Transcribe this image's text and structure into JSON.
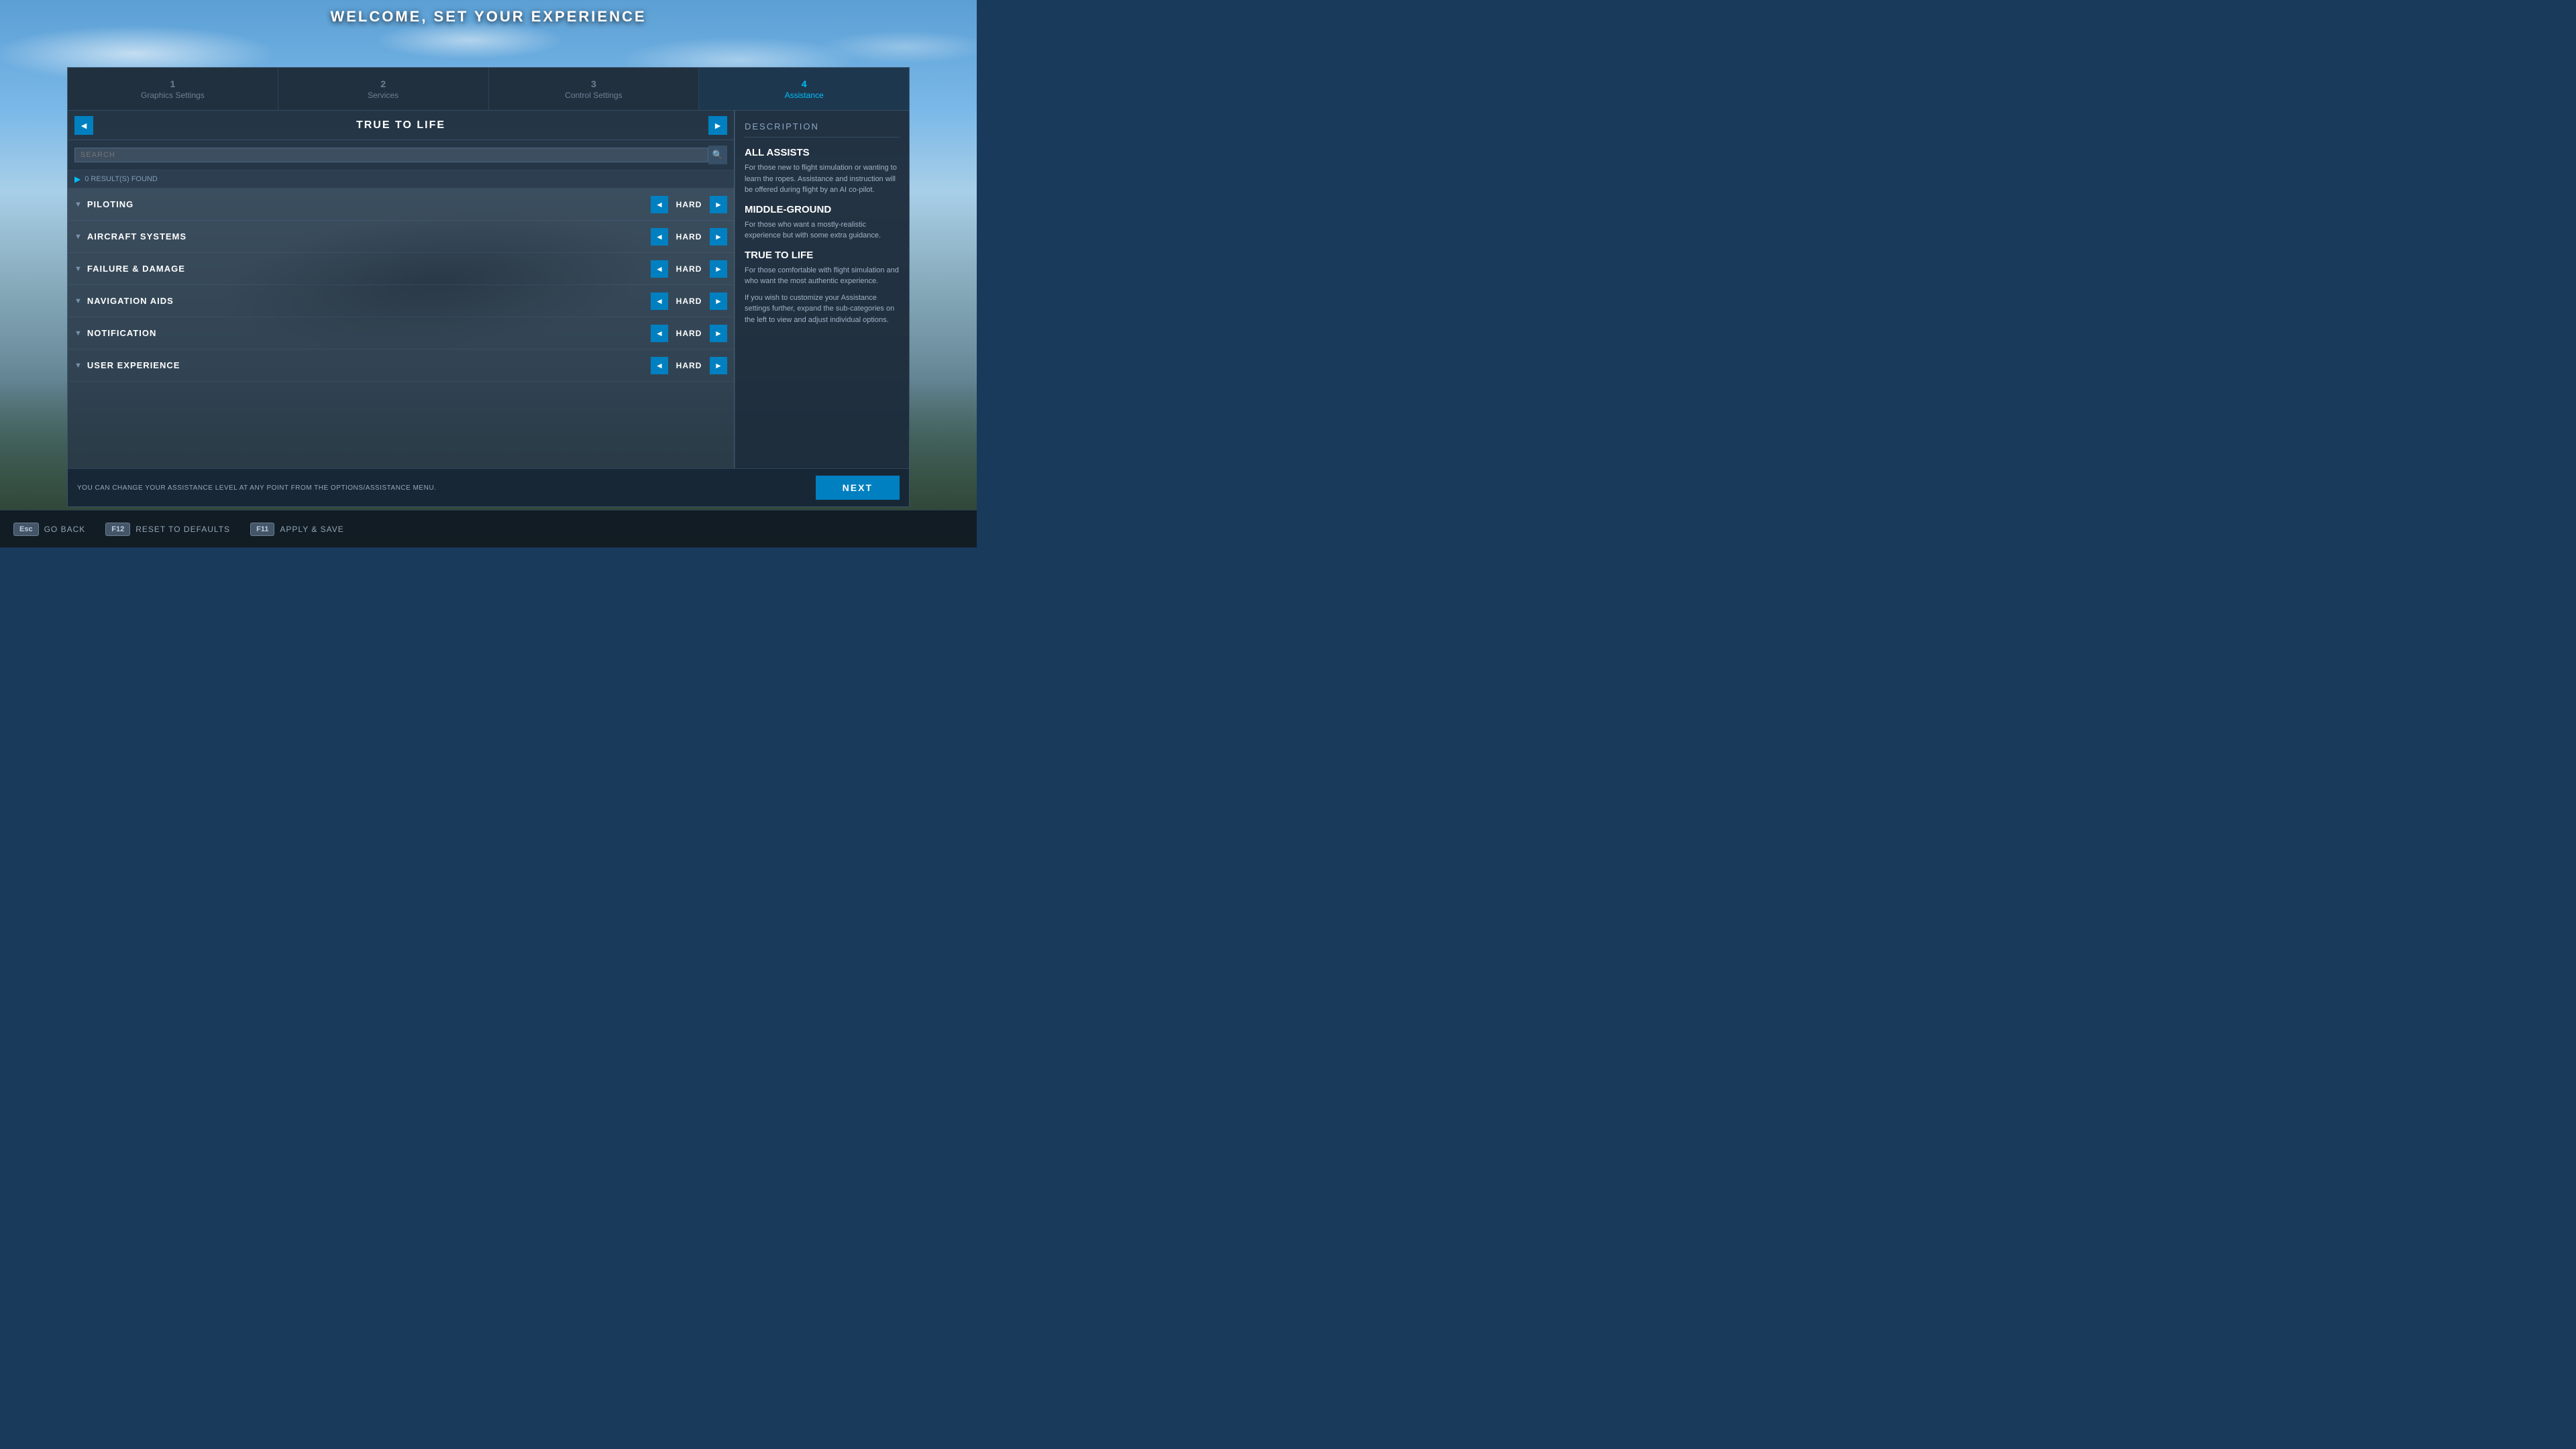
{
  "page": {
    "title": "WELCOME, SET YOUR EXPERIENCE",
    "background_desc": "aerial sky view with aircraft"
  },
  "steps": [
    {
      "number": "1",
      "label": "Graphics Settings",
      "active": false
    },
    {
      "number": "2",
      "label": "Services",
      "active": false
    },
    {
      "number": "3",
      "label": "Control Settings",
      "active": false
    },
    {
      "number": "4",
      "label": "Assistance",
      "active": true
    }
  ],
  "panel": {
    "prev_arrow": "◄",
    "next_arrow": "►",
    "title": "TRUE TO LIFE",
    "search_placeholder": "SEARCH",
    "results": "0 RESULT(S) FOUND"
  },
  "categories": [
    {
      "name": "PILOTING",
      "value": "HARD"
    },
    {
      "name": "AIRCRAFT SYSTEMS",
      "value": "HARD"
    },
    {
      "name": "FAILURE & DAMAGE",
      "value": "HARD"
    },
    {
      "name": "NAVIGATION AIDS",
      "value": "HARD"
    },
    {
      "name": "NOTIFICATION",
      "value": "HARD"
    },
    {
      "name": "USER EXPERIENCE",
      "value": "HARD"
    }
  ],
  "description": {
    "header": "DESCRIPTION",
    "sections": [
      {
        "title": "ALL ASSISTS",
        "text": "For those new to flight simulation or wanting to learn the ropes. Assistance and instruction will be offered during flight by an AI co-pilot."
      },
      {
        "title": "MIDDLE-GROUND",
        "text": "For those who want a mostly-realistic experience but with some extra guidance."
      },
      {
        "title": "TRUE TO LIFE",
        "text": "For those comfortable with flight simulation and who want the most authentic experience."
      },
      {
        "title": "",
        "text": "If you wish to customize your Assistance settings further, expand the sub-categories on the left to view and adjust individual options."
      }
    ]
  },
  "footer": {
    "note": "YOU CAN CHANGE YOUR ASSISTANCE LEVEL AT ANY POINT FROM THE OPTIONS/ASSISTANCE MENU.",
    "next_button": "NEXT"
  },
  "keyboard_shortcuts": [
    {
      "key": "Esc",
      "label": "GO BACK"
    },
    {
      "key": "F12",
      "label": "RESET TO DEFAULTS"
    },
    {
      "key": "F11",
      "label": "APPLY & SAVE"
    }
  ]
}
